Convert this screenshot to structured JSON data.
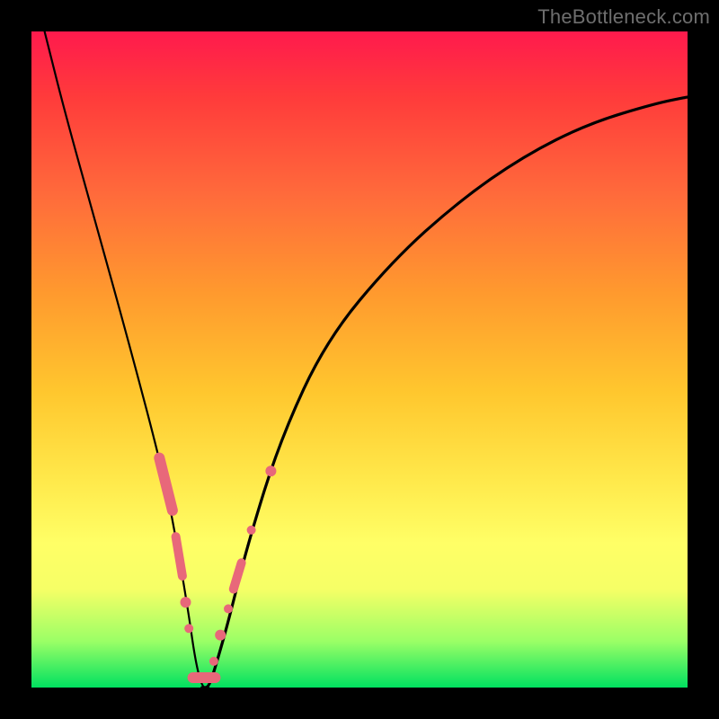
{
  "watermark": "TheBottleneck.com",
  "colors": {
    "background_frame": "#000000",
    "gradient_top": "#ff1a4d",
    "gradient_bottom": "#00e060",
    "curve_stroke": "#000000",
    "marker_fill": "#e8687a"
  },
  "chart_data": {
    "type": "line",
    "title": "",
    "xlabel": "",
    "ylabel": "",
    "xlim": [
      0,
      100
    ],
    "ylim": [
      0,
      100
    ],
    "grid": false,
    "series": [
      {
        "name": "bottleneck-curve",
        "x": [
          2,
          5,
          10,
          15,
          20,
          22,
          24,
          25,
          26,
          27,
          28,
          30,
          33,
          38,
          45,
          55,
          65,
          75,
          85,
          95,
          100
        ],
        "y": [
          100,
          88,
          70,
          52,
          33,
          23,
          11,
          4,
          0,
          0,
          3,
          10,
          22,
          38,
          53,
          65,
          74,
          81,
          86,
          89,
          90
        ]
      }
    ],
    "markers": [
      {
        "name": "left-cluster-a",
        "kind": "pill",
        "x1": 19.5,
        "y1": 35,
        "x2": 21.5,
        "y2": 27,
        "r": 6
      },
      {
        "name": "left-cluster-b",
        "kind": "pill",
        "x1": 22.0,
        "y1": 23,
        "x2": 23.0,
        "y2": 17,
        "r": 5
      },
      {
        "name": "left-dot-1",
        "kind": "circle",
        "cx": 23.5,
        "cy": 13,
        "r": 6
      },
      {
        "name": "left-dot-2",
        "kind": "circle",
        "cx": 24.0,
        "cy": 9,
        "r": 5
      },
      {
        "name": "bottom-pill",
        "kind": "pill",
        "x1": 24.6,
        "y1": 1.5,
        "x2": 28.0,
        "y2": 1.5,
        "r": 6
      },
      {
        "name": "right-dot-1",
        "kind": "circle",
        "cx": 27.8,
        "cy": 4,
        "r": 5
      },
      {
        "name": "right-dot-2",
        "kind": "circle",
        "cx": 28.8,
        "cy": 8,
        "r": 6
      },
      {
        "name": "right-dot-3",
        "kind": "circle",
        "cx": 30.0,
        "cy": 12,
        "r": 5
      },
      {
        "name": "right-pill-a",
        "kind": "pill",
        "x1": 30.8,
        "y1": 15,
        "x2": 32.0,
        "y2": 19,
        "r": 5
      },
      {
        "name": "right-dot-4",
        "kind": "circle",
        "cx": 33.5,
        "cy": 24,
        "r": 5
      },
      {
        "name": "right-dot-5",
        "kind": "circle",
        "cx": 36.5,
        "cy": 33,
        "r": 6
      }
    ]
  }
}
